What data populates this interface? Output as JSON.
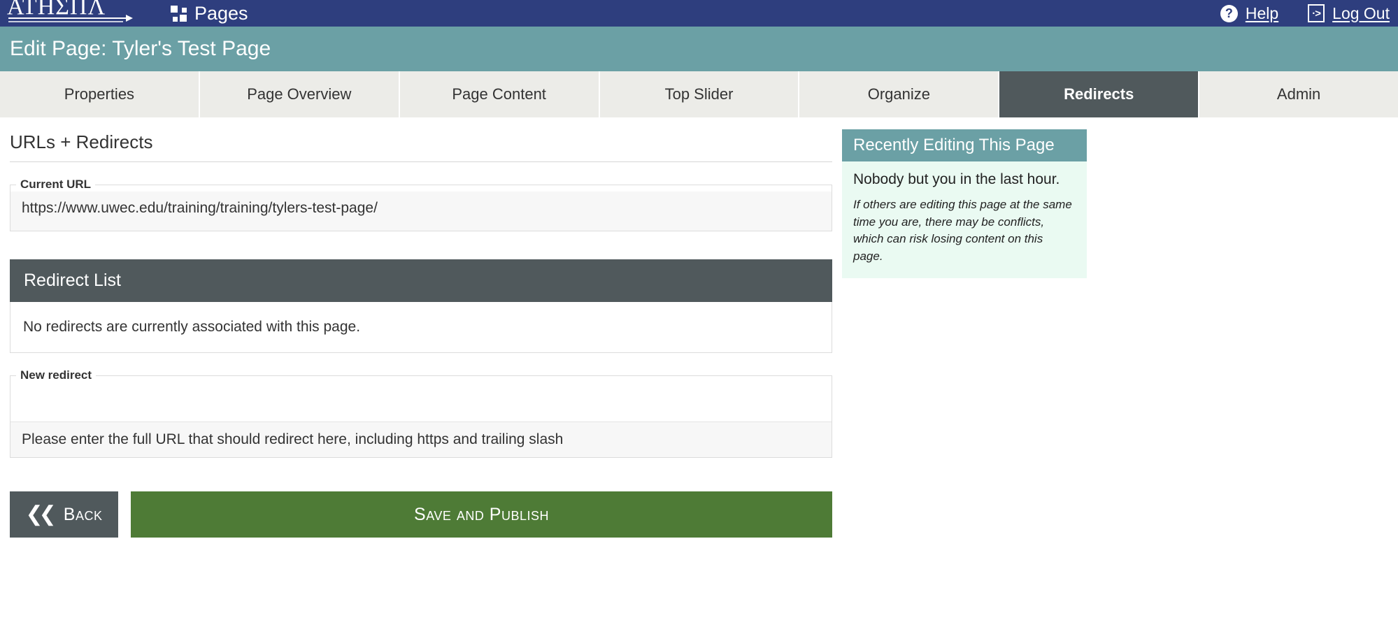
{
  "topbar": {
    "brand": "ATHENA",
    "nav_label": "Pages",
    "grid_icon": "grid-icon",
    "help_label": "Help",
    "help_icon": "question-circle-icon",
    "logout_label": "Log Out",
    "logout_icon": "exit-door-icon",
    "bg_color": "#2e3e7e"
  },
  "title_band": {
    "title": "Edit Page: Tyler's Test Page",
    "bg_color": "#6ba0a5"
  },
  "tabs": [
    {
      "label": "Properties",
      "active": false
    },
    {
      "label": "Page Overview",
      "active": false
    },
    {
      "label": "Page Content",
      "active": false
    },
    {
      "label": "Top Slider",
      "active": false
    },
    {
      "label": "Organize",
      "active": false
    },
    {
      "label": "Redirects",
      "active": true
    },
    {
      "label": "Admin",
      "active": false
    }
  ],
  "main": {
    "section_title": "URLs + Redirects",
    "current_url": {
      "legend": "Current URL",
      "value": "https://www.uwec.edu/training/training/tylers-test-page/"
    },
    "redirect_list": {
      "header": "Redirect List",
      "empty_message": "No redirects are currently associated with this page."
    },
    "new_redirect": {
      "legend": "New redirect",
      "value": "",
      "placeholder": "",
      "help_text": "Please enter the full URL that should redirect here, including https and trailing slash"
    }
  },
  "sidebar": {
    "header": "Recently Editing This Page",
    "lead": "Nobody but you in the last hour.",
    "note": "If others are editing this page at the same time you are, there may be conflicts, which can risk losing content on this page.",
    "header_color": "#6ba0a5",
    "body_color": "#eafaf2"
  },
  "actions": {
    "back_label": "Back",
    "back_icon": "double-chevron-left-icon",
    "save_label": "Save and Publish",
    "save_color": "#4e7b36",
    "back_color": "#50595c"
  }
}
